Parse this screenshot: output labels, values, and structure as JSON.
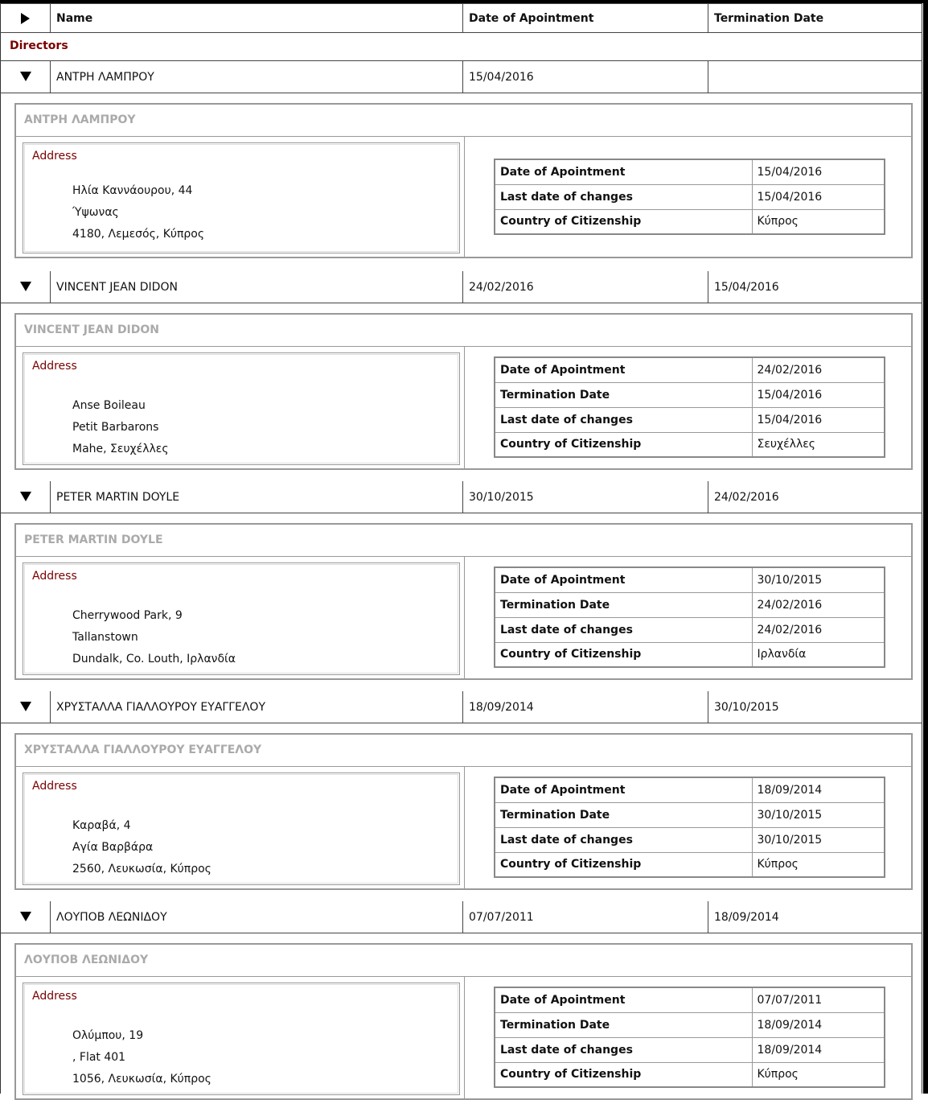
{
  "table": {
    "headers": {
      "name": "Name",
      "date_of_appointment": "Date of Apointment",
      "termination_date": "Termination Date"
    },
    "section_title": "Directors"
  },
  "labels": {
    "address": "Address",
    "date_of_appointment": "Date of Apointment",
    "termination_date": "Termination Date",
    "last_date_of_changes": "Last date of changes",
    "country_of_citizenship": "Country of Citizenship"
  },
  "directors": [
    {
      "name": "ΑΝΤΡΗ ΛΑΜΠΡΟΥ",
      "appointment": "15/04/2016",
      "termination": "",
      "last_changes": "15/04/2016",
      "citizenship": "Κύπρος",
      "address": [
        "Ηλία Καννάουρου, 44",
        "Ύψωνας",
        "4180, Λεμεσός, Κύπρος"
      ]
    },
    {
      "name": "VINCENT JEAN DIDON",
      "appointment": "24/02/2016",
      "termination": "15/04/2016",
      "last_changes": "15/04/2016",
      "citizenship": "Σευχέλλες",
      "address": [
        "Anse Boileau",
        "Petit Barbarons",
        "Mahe, Σευχέλλες"
      ]
    },
    {
      "name": "PETER MARTIN DOYLE",
      "appointment": "30/10/2015",
      "termination": "24/02/2016",
      "last_changes": "24/02/2016",
      "citizenship": "Ιρλανδία",
      "address": [
        "Cherrywood Park, 9",
        "Tallanstown",
        "Dundalk, Co. Louth, Ιρλανδία"
      ]
    },
    {
      "name": "ΧΡΥΣΤΑΛΛΑ ΓΙΑΛΛΟΥΡΟΥ ΕΥΑΓΓΕΛΟΥ",
      "appointment": "18/09/2014",
      "termination": "30/10/2015",
      "last_changes": "30/10/2015",
      "citizenship": "Κύπρος",
      "address": [
        "Καραβά, 4",
        "Αγία Βαρβάρα",
        "2560, Λευκωσία, Κύπρος"
      ]
    },
    {
      "name": "ΛΟΥΠΟΒ ΛΕΩΝΙΔΟΥ",
      "appointment": "07/07/2011",
      "termination": "18/09/2014",
      "last_changes": "18/09/2014",
      "citizenship": "Κύπρος",
      "address": [
        "Ολύμπου, 19",
        ", Flat 401",
        "1056, Λευκωσία, Κύπρος"
      ]
    }
  ]
}
